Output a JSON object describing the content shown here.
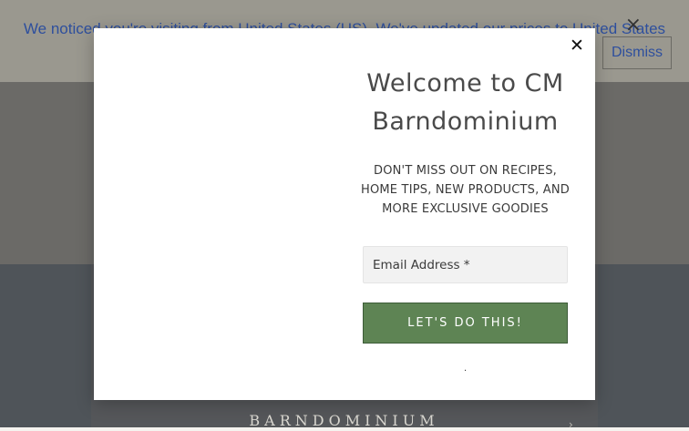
{
  "banner": {
    "message": "We noticed you're visiting from United States (US). We've updated our prices to United States (US) dollar for your shopping convenience.",
    "dismiss_label": "Dismiss",
    "close_glyph": "×"
  },
  "modal": {
    "close_glyph": "✕",
    "title": "Welcome to CM Barndominium",
    "subtitle": "DON'T MISS OUT ON RECIPES, HOME TIPS, NEW PRODUCTS, AND MORE EXCLUSIVE GOODIES",
    "email_placeholder": "Email Address *",
    "submit_label": "LET'S DO THIS!",
    "dot": "."
  },
  "footer": {
    "logo_text": "BARNDOMINIUM",
    "chevron": "›"
  },
  "colors": {
    "submit_bg": "#5e8454",
    "banner_text": "#2e4f9d"
  }
}
